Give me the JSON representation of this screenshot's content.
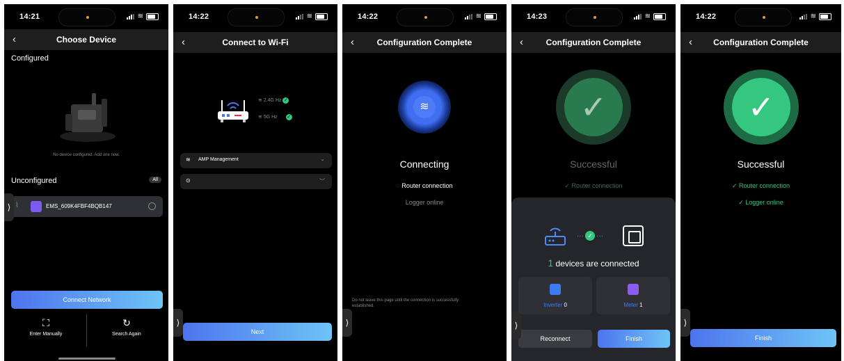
{
  "screens": [
    {
      "time": "14:21",
      "title": "Choose Device",
      "configured_label": "Configured",
      "empty_text": "No device configured. Add one now.",
      "unconfigured_label": "Unconfigured",
      "all_badge": "All",
      "device_name": "EMS_609K4FBF4BQB147",
      "connect_button": "Connect Network",
      "enter_manually": "Enter Manually",
      "search_again": "Search Again"
    },
    {
      "time": "14:22",
      "title": "Connect to Wi-Fi",
      "band_24": "2.4G Hz",
      "band_5": "5G Hz",
      "ssid_value": "AMP Management",
      "password_value": "",
      "next_button": "Next"
    },
    {
      "time": "14:22",
      "title": "Configuration Complete",
      "status": "Connecting",
      "step_router": "Router connection",
      "step_logger": "Logger online",
      "warning": "Do not leave this page until the connection is successfully established."
    },
    {
      "time": "14:23",
      "title": "Configuration Complete",
      "status": "Successful",
      "step_router": "Router connection",
      "count": "1",
      "connected_text": "devices are connected",
      "inverter_label": "Inverter",
      "inverter_count": "0",
      "meter_label": "Meter",
      "meter_count": "1",
      "reconnect_button": "Reconnect",
      "finish_button": "Finish"
    },
    {
      "time": "14:22",
      "title": "Configuration Complete",
      "status": "Successful",
      "step_router": "Router connection",
      "step_logger": "Logger online",
      "finish_button": "Finish"
    }
  ],
  "colors": {
    "accent_blue": "#4d74ee",
    "success_green": "#34c77f"
  }
}
